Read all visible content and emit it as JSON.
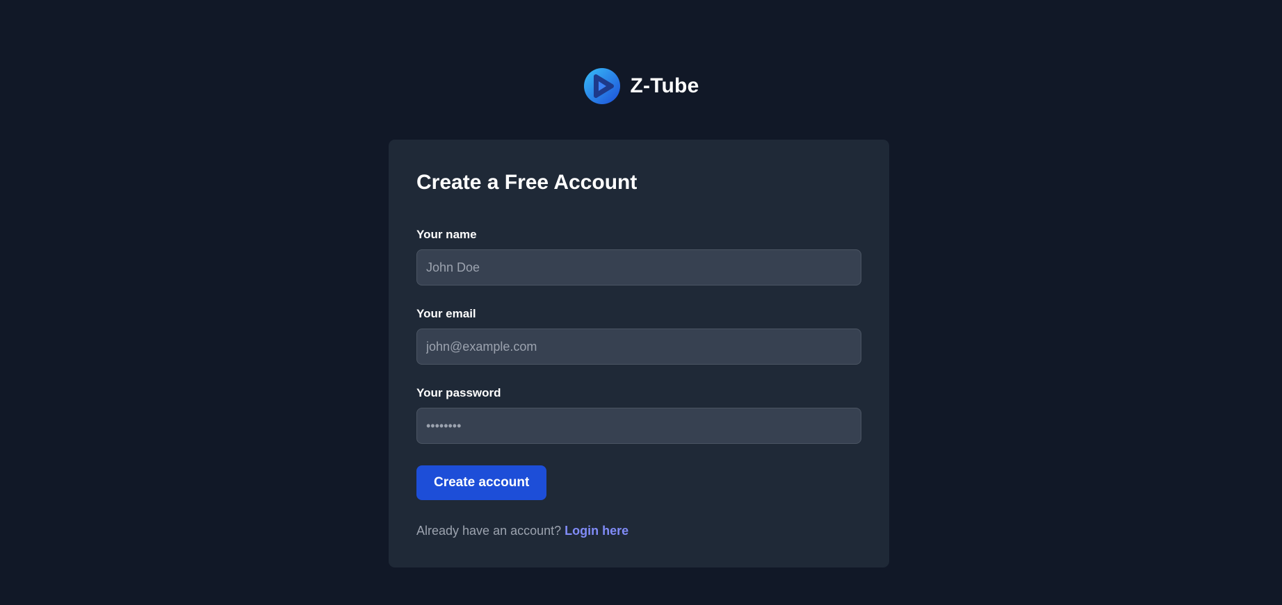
{
  "brand": {
    "name": "Z-Tube",
    "logo_icon": "play-logo-icon",
    "logo_colors": [
      "#1e3a8a",
      "#2563eb",
      "#38bdf8"
    ]
  },
  "form": {
    "title": "Create a Free Account",
    "fields": [
      {
        "label": "Your name",
        "placeholder": "John Doe",
        "type": "text"
      },
      {
        "label": "Your email",
        "placeholder": "john@example.com",
        "type": "email"
      },
      {
        "label": "Your password",
        "placeholder": "••••••••",
        "type": "password"
      }
    ],
    "submit_label": "Create account",
    "signin_prompt": "Already have an account?",
    "signin_link": "Login here"
  },
  "colors": {
    "page_background": "#111827",
    "card_background": "#1f2937",
    "input_background": "#374151",
    "primary_button": "#1d4ed8",
    "link": "#818cf8"
  }
}
